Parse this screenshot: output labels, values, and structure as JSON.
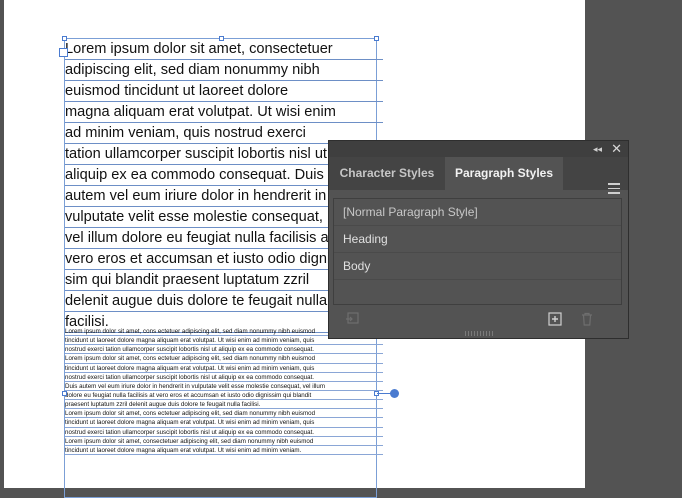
{
  "document": {
    "big_lines": [
      "Lorem ipsum dolor sit amet, consectetuer",
      "adipiscing elit, sed diam nonummy nibh",
      "euismod tincidunt ut laoreet dolore",
      "magna aliquam erat volutpat. Ut wisi enim",
      "ad minim veniam, quis nostrud exerci",
      "tation ullamcorper suscipit lobortis nisl ut",
      "aliquip ex ea commodo consequat. Duis",
      "autem vel eum iriure dolor in hendrerit in",
      "vulputate velit esse molestie consequat,",
      "vel illum dolore eu feugiat nulla facilisis at",
      "vero eros et accumsan et iusto odio digni",
      "sim qui blandit praesent luptatum zzril",
      "delenit augue duis dolore te feugait nulla",
      "facilisi."
    ],
    "small_lines": [
      "Lorem ipsum dolor sit amet, cons ectetuer adipiscing elit, sed diam nonummy nibh euismod",
      "tincidunt ut laoreet dolore magna aliquam erat volutpat. Ut wisi enim ad minim veniam, quis",
      "nostrud exerci tation ullamcorper suscipit lobortis nisl ut aliquip ex ea commodo consequat.",
      "Lorem ipsum dolor sit amet, cons ectetuer adipiscing elit, sed diam nonummy nibh euismod",
      "tincidunt ut laoreet dolore magna aliquam erat volutpat. Ut wisi enim ad minim veniam, quis",
      "nostrud exerci tation ullamcorper suscipit lobortis nisl ut aliquip ex ea commodo consequat.",
      "Duis autem vel eum iriure dolor in hendrerit in vulputate velit esse molestie consequat, vel illum",
      "dolore eu feugiat nulla facilisis at vero eros et accumsan et iusto odio dignissim qui blandit",
      "praesent luptatum zzril delenit augue duis dolore te feugait nulla facilisi.",
      "Lorem ipsum dolor sit amet, cons ectetuer adipiscing elit, sed diam nonummy nibh euismod",
      "tincidunt ut laoreet dolore magna aliquam erat volutpat. Ut wisi enim ad minim veniam, quis",
      "nostrud exerci tation ullamcorper suscipit lobortis nisl ut aliquip ex ea commodo consequat.",
      "Lorem ipsum dolor sit amet, consectetuer adipiscing elit, sed diam nonummy nibh euismod",
      "tincidunt ut laoreet dolore magna aliquam erat volutpat. Ut wisi enim ad minim veniam."
    ]
  },
  "panel": {
    "collapse_icon": "double-chevron-left-icon",
    "collapse_glyph": "◂◂",
    "close_glyph": "✕",
    "tabs": [
      {
        "label": "Character Styles",
        "active": false
      },
      {
        "label": "Paragraph Styles",
        "active": true
      }
    ],
    "styles": [
      {
        "label": "[Normal Paragraph Style]"
      },
      {
        "label": "Heading"
      },
      {
        "label": "Body"
      }
    ]
  },
  "colors": {
    "selection": "#4a7bd0",
    "panel_bg": "#535353",
    "artboard": "#ffffff"
  }
}
